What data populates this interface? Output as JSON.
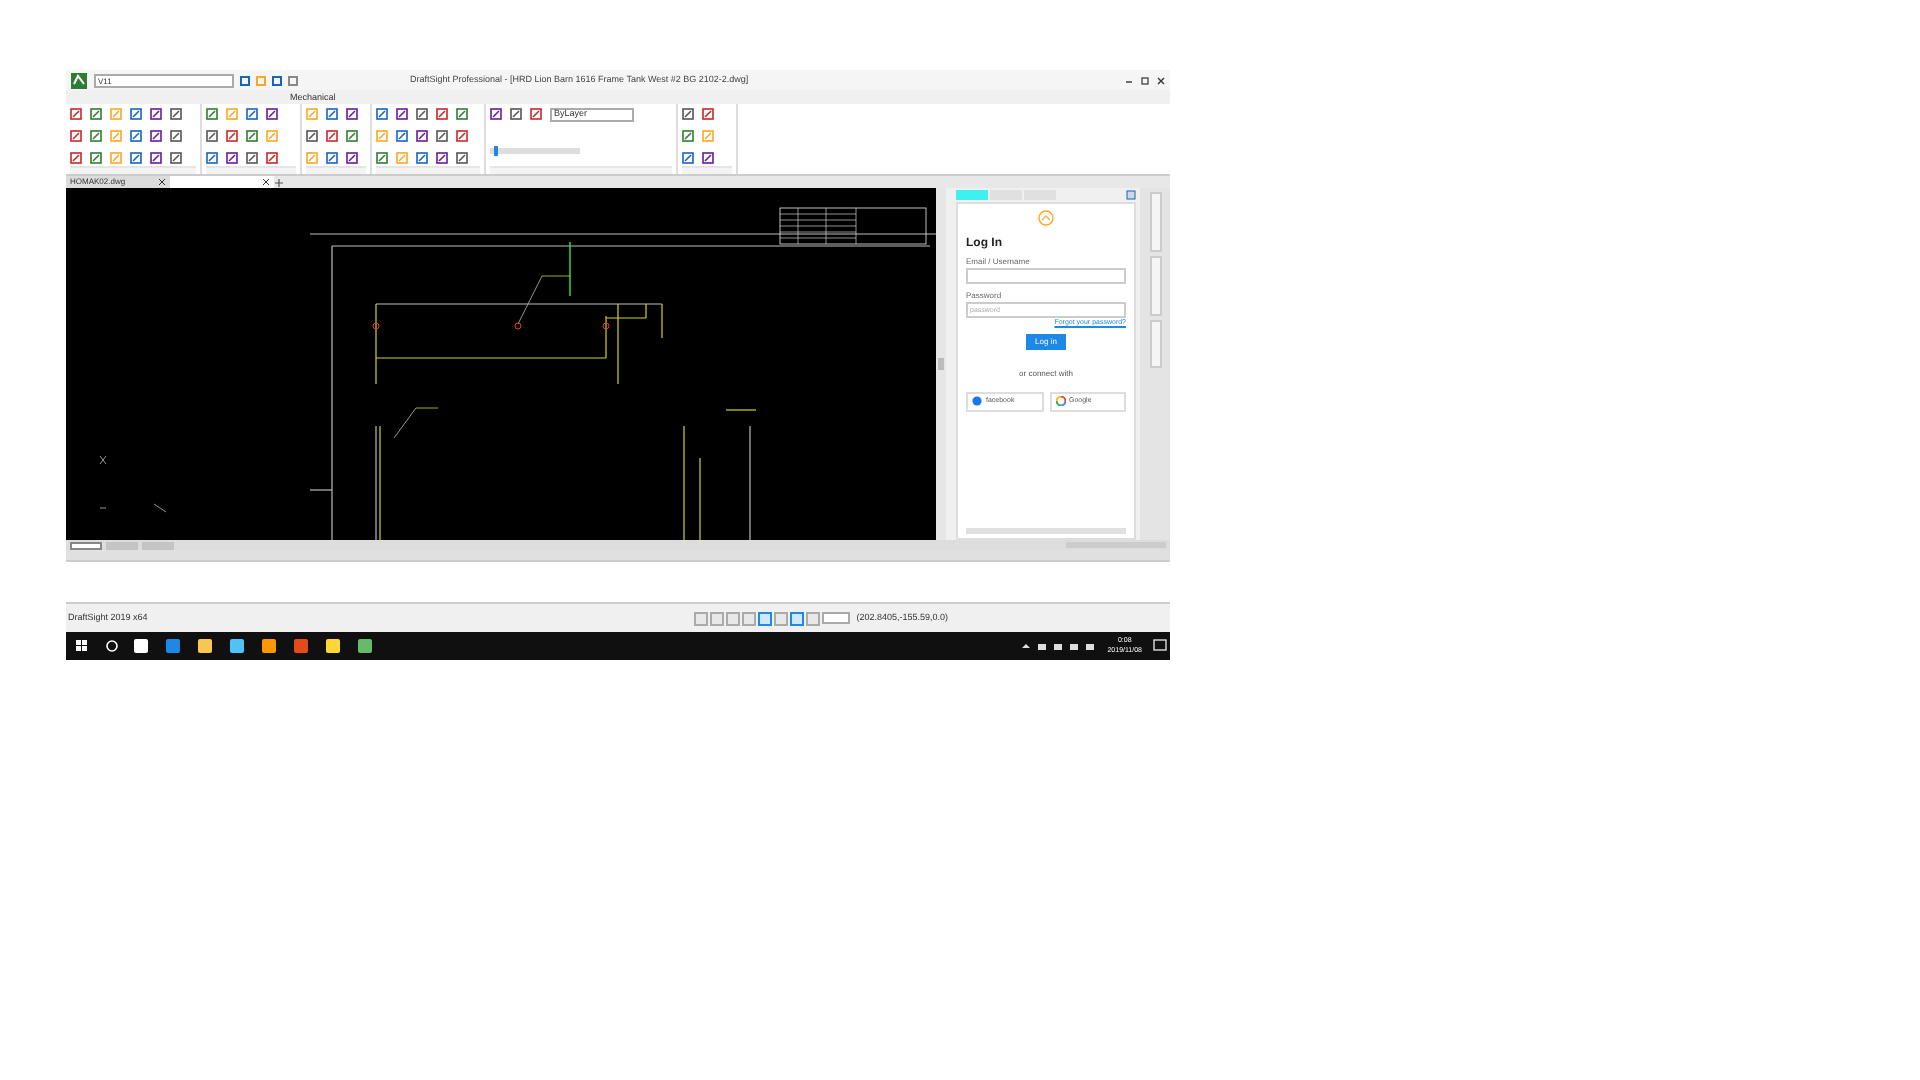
{
  "window": {
    "title": "DraftSight Professional - [HRD Lion Barn 1616 Frame Tank West #2 BG 2102-2.dwg]",
    "quick_access_value": "V11"
  },
  "ribbon_tabs": [
    {
      "label": "Mechanical",
      "selected": false
    }
  ],
  "ribbon_fields": [
    {
      "value": "ByLayer"
    }
  ],
  "ribbon_slider": {
    "level": 0.05
  },
  "layout_tabs": [
    {
      "selected": true
    },
    {
      "selected": false
    },
    {
      "selected": false
    }
  ],
  "document_tabs": [
    {
      "label": "HOMAK02.dwg",
      "selected": false
    },
    {
      "selected": true
    }
  ],
  "side_panel": {
    "tabs": [
      {
        "selected": true
      },
      {
        "selected": false
      },
      {
        "selected": false
      }
    ],
    "login": {
      "heading": "Log In",
      "email_label": "Email / Username",
      "password_label": "Password",
      "password_placeholder": "password",
      "forgot_link": "Forgot your password?",
      "login_button": "Log in",
      "connect_text": "or connect with",
      "social_buttons": [
        {
          "kind": "facebook",
          "label": "facebook"
        },
        {
          "kind": "google",
          "label": "Google"
        }
      ]
    }
  },
  "status_bar": {
    "app": "DraftSight 2019 x64",
    "toggles": [
      {
        "on": false
      },
      {
        "on": false
      },
      {
        "on": false
      },
      {
        "on": false
      },
      {
        "on": true
      },
      {
        "on": false
      },
      {
        "on": true
      },
      {
        "on": false
      }
    ],
    "coordinates": "(202.8405,-155.59,0.0)"
  },
  "taskbar": {
    "time": "0:08",
    "date": "2019/11/08"
  }
}
